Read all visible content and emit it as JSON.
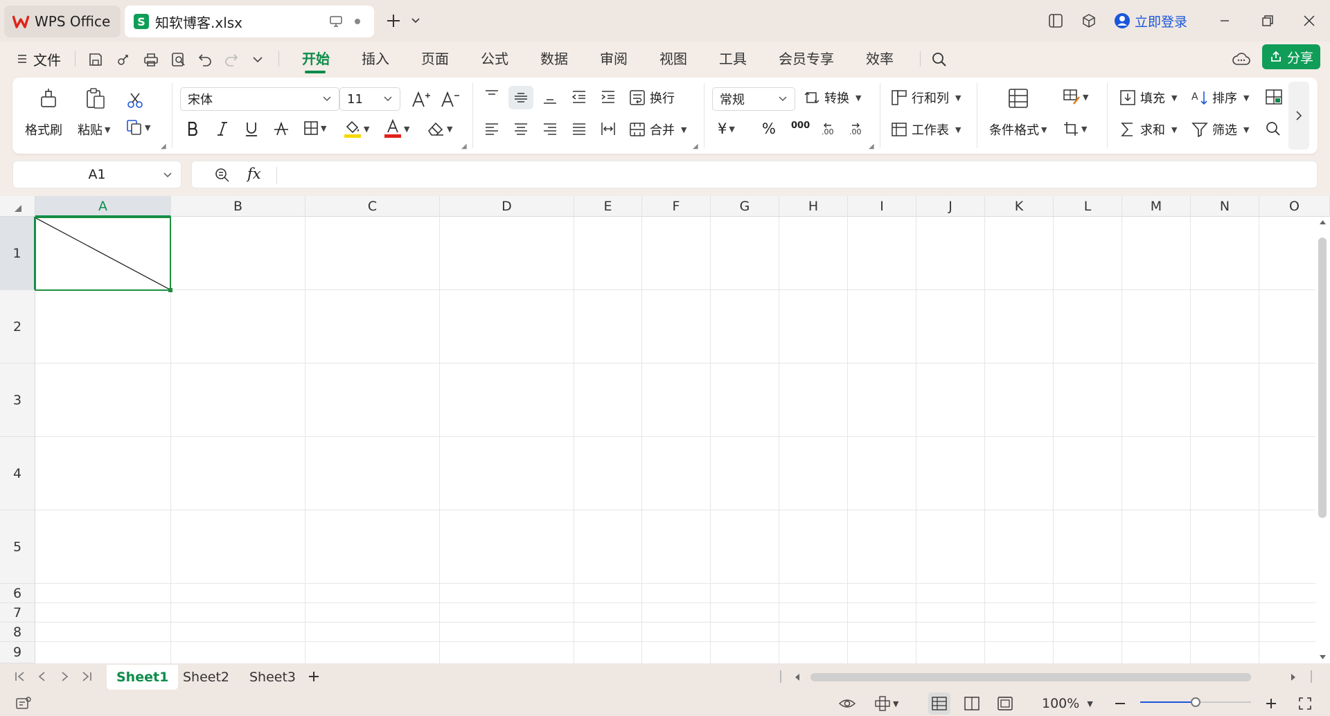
{
  "titlebar": {
    "app_tab": "WPS Office",
    "file_tab": "知软博客.xlsx",
    "login": "立即登录"
  },
  "menu": {
    "file": "文件",
    "tabs": [
      "开始",
      "插入",
      "页面",
      "公式",
      "数据",
      "审阅",
      "视图",
      "工具",
      "会员专享",
      "效率"
    ],
    "share": "分享"
  },
  "ribbon": {
    "format_painter": "格式刷",
    "paste": "粘贴",
    "font_name": "宋体",
    "font_size": "11",
    "wrap": "换行",
    "merge": "合并",
    "number_format": "常规",
    "convert": "转换",
    "rows_cols": "行和列",
    "worksheet": "工作表",
    "conditional_format": "条件格式",
    "fill": "填充",
    "sort": "排序",
    "sum": "求和",
    "filter": "筛选",
    "currency_symbol": "¥",
    "percent_symbol": "%",
    "thousands_symbol": "000",
    "accent_colors": {
      "highlight": "#f5d90a",
      "font_color": "#e0231a",
      "brand": "#0d8c4a"
    }
  },
  "formula_bar": {
    "cell_ref": "A1",
    "fx": "fx",
    "value": ""
  },
  "grid": {
    "columns": [
      "A",
      "B",
      "C",
      "D",
      "E",
      "F",
      "G",
      "H",
      "I",
      "J",
      "K",
      "L",
      "M",
      "N",
      "O"
    ],
    "rows": [
      "1",
      "2",
      "3",
      "4",
      "5",
      "6",
      "7",
      "8",
      "9"
    ],
    "selected_cell": "A1"
  },
  "sheets": {
    "tabs": [
      "Sheet1",
      "Sheet2",
      "Sheet3"
    ],
    "active": "Sheet1"
  },
  "status": {
    "zoom": "100%",
    "zoom_level": 0.5
  }
}
